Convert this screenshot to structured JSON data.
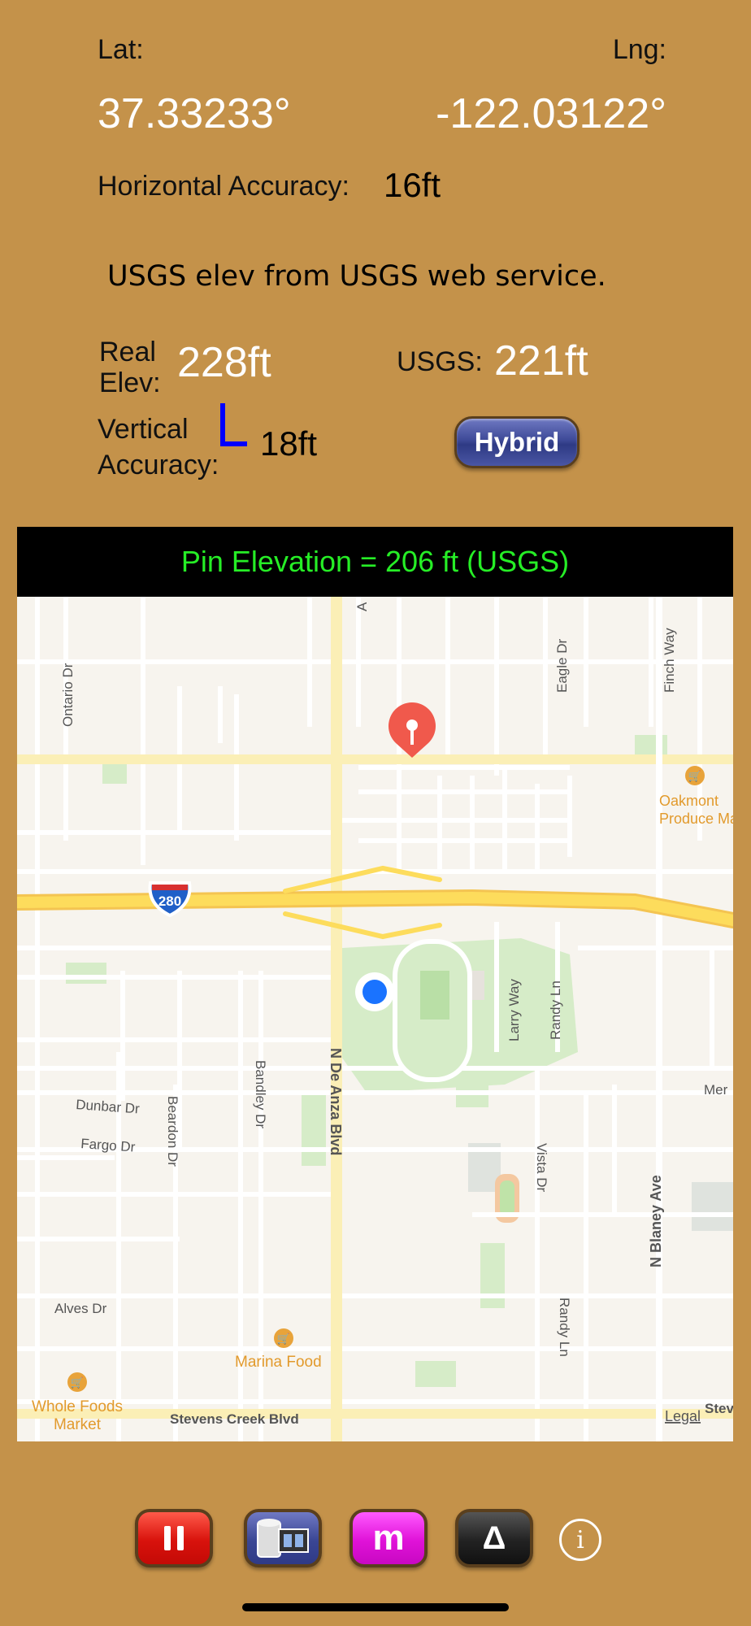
{
  "coords": {
    "lat_label": "Lat:",
    "lng_label": "Lng:",
    "lat_value": "37.33233°",
    "lng_value": "-122.03122°"
  },
  "accuracy": {
    "horizontal_label": "Horizontal Accuracy:",
    "horizontal_value": "16ft",
    "vertical_label_1": "Vertical",
    "vertical_label_2": "Accuracy:",
    "vertical_value": "18ft"
  },
  "source_note": "USGS elev from USGS web service.",
  "elevation": {
    "real_label_1": "Real",
    "real_label_2": "Elev:",
    "real_value": "228ft",
    "usgs_label": "USGS:",
    "usgs_value": "221ft"
  },
  "map_type_button": "Hybrid",
  "pin_banner": "Pin Elevation = 206 ft (USGS)",
  "map": {
    "streets": {
      "ontario": "Ontario Dr",
      "eagle": "Eagle Dr",
      "finch": "Finch Way",
      "de_anza": "N De Anza Blvd",
      "bandley": "Bandley Dr",
      "beardon": "Beardon Dr",
      "dunbar": "Dunbar Dr",
      "fargo": "Fargo Dr",
      "larry": "Larry Way",
      "randy_top": "Randy Ln",
      "randy_bottom": "Randy Ln",
      "vista": "Vista Dr",
      "blaney": "N Blaney Ave",
      "alves": "Alves Dr",
      "stevens_creek": "Stevens Creek Blvd",
      "mer": "Mer",
      "steve": "Steve",
      "a_fragment": "A"
    },
    "highway_shield": "280",
    "pois": {
      "oakmont_1": "Oakmont",
      "oakmont_2": "Produce Mar",
      "marina": "Marina Food",
      "whole_foods_1": "Whole Foods",
      "whole_foods_2": "Market"
    },
    "legal": "Legal"
  },
  "toolbar": {
    "m_label": "m",
    "delta_label": "Δ",
    "info_label": "i"
  },
  "colors": {
    "background": "#c4924a",
    "banner_text": "#26ee26",
    "vertical_indicator": "#0000ff",
    "user_location": "#1a73ff",
    "pin": "#f0594c"
  }
}
